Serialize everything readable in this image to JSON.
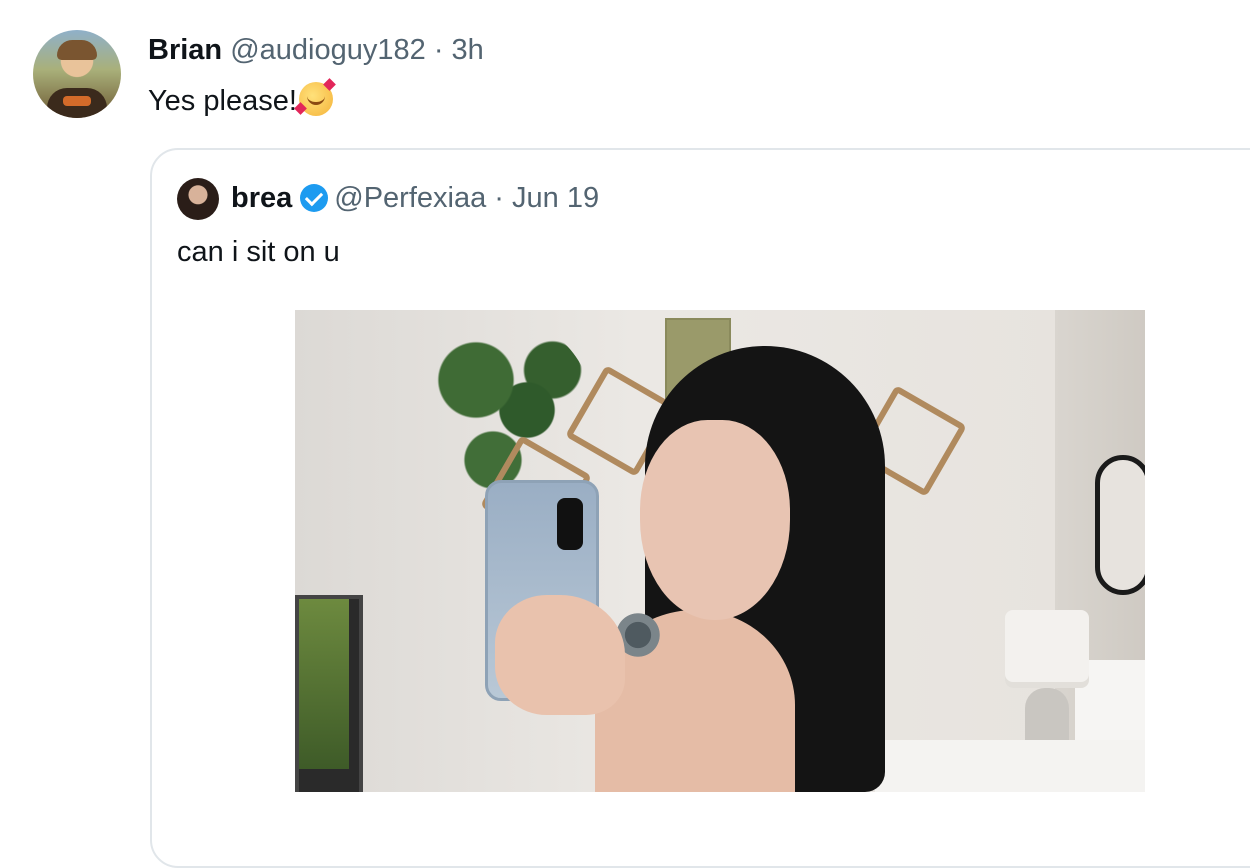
{
  "reply": {
    "display_name": "Brian",
    "handle": "@audioguy182",
    "separator": "·",
    "time": "3h",
    "text": "Yes please!",
    "avatar_icon": "user-avatar",
    "emoji_icon": "smiling-face-with-hearts-emoji"
  },
  "quoted": {
    "display_name": "brea",
    "verified_icon": "verified-badge-icon",
    "handle": "@Perfexiaa",
    "separator": "·",
    "date": "Jun 19",
    "text": "can i sit on u",
    "media": "mirror-selfie-photo"
  },
  "colors": {
    "text": "#0f1419",
    "secondary": "#536471",
    "border": "#e1e6ea",
    "verified": "#1d9bf0"
  }
}
